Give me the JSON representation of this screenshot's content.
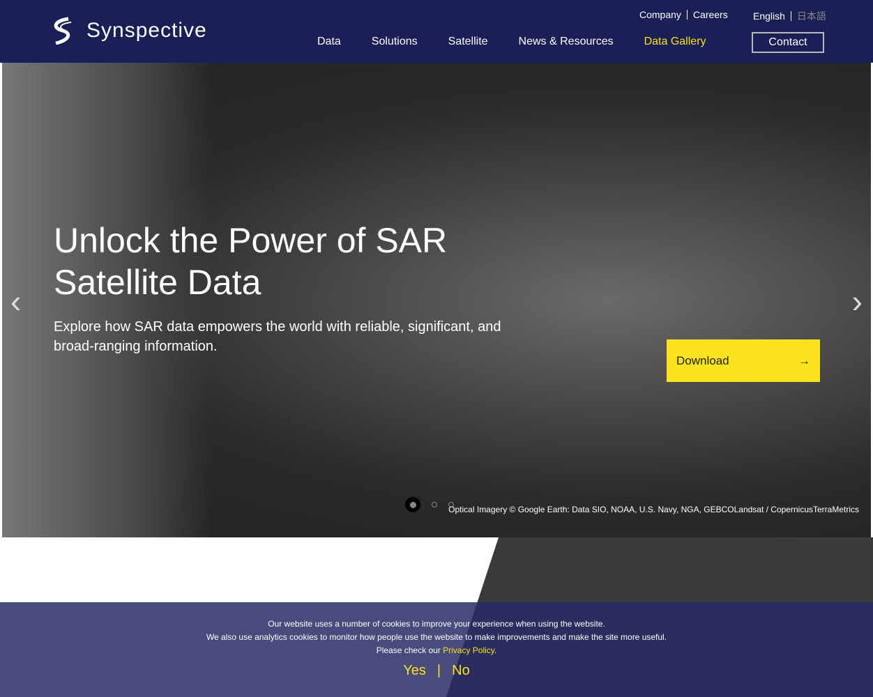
{
  "header": {
    "logo": "Synspective",
    "util": [
      "Company",
      "Careers"
    ],
    "lang": [
      "English",
      "日本語"
    ],
    "nav": [
      "Data",
      "Solutions",
      "Satellite",
      "News & Resources",
      "Data Gallery"
    ],
    "active": "Data Gallery",
    "contact": "Contact"
  },
  "hero": {
    "title": "Unlock the Power of SAR Satellite Data",
    "subtitle": "Explore how SAR data empowers the world with reliable, significant, and broad-ranging information.",
    "download": "Download",
    "credit": "Optical Imagery © Google Earth: Data SIO, NOAA, U.S. Navy, NGA, GEBCOLandsat / CopernicusTerraMetrics",
    "slide_index": 1,
    "slide_count": 3
  },
  "cookie": {
    "line1": "Our website uses a number of cookies to improve your experience when using the website.",
    "line2": "We also use analytics cookies to monitor how people use the website to make improvements and make the site more useful.",
    "line3": "Please check our ",
    "link": "Privacy Policy",
    "period": ".",
    "yes": "Yes",
    "sep": "|",
    "no": "No"
  },
  "colors": {
    "navy": "#1c1f55",
    "accent": "#f8e21c"
  }
}
